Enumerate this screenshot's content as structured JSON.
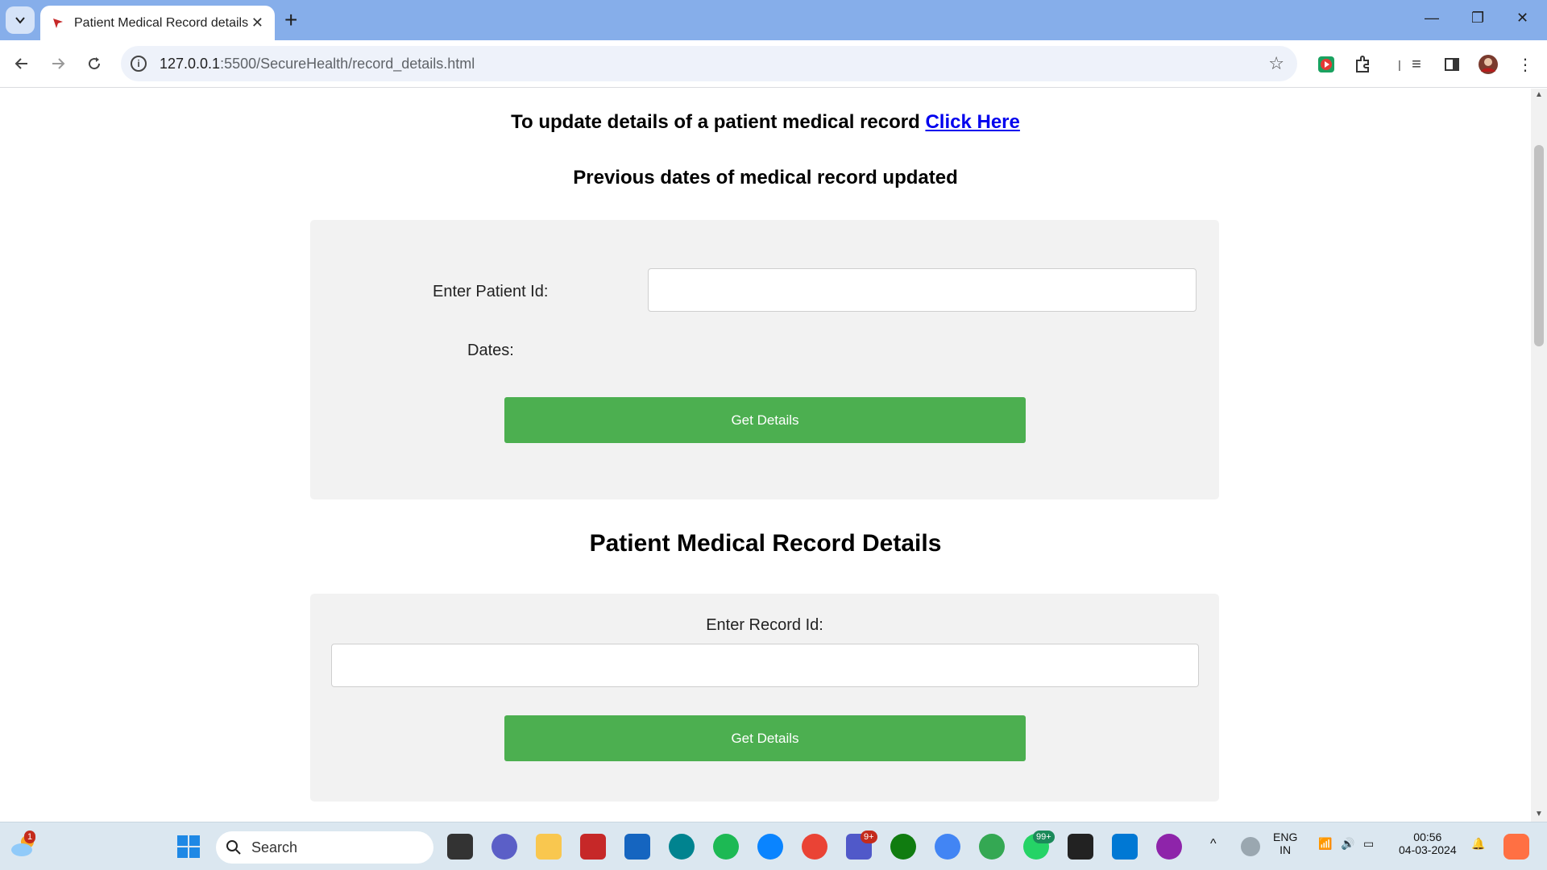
{
  "browser": {
    "tab_title": "Patient Medical Record details",
    "url_host": "127.0.0.1",
    "url_path": ":5500/SecureHealth/record_details.html"
  },
  "page": {
    "update_text": "To update details of a patient medical record",
    "update_link": "Click Here",
    "prev_dates_title": "Previous dates of medical record updated",
    "form1": {
      "patient_id_label": "Enter Patient Id:",
      "patient_id_value": "",
      "dates_label": "Dates:",
      "button_label": "Get Details"
    },
    "details_title": "Patient Medical Record Details",
    "form2": {
      "record_id_label": "Enter Record Id:",
      "record_id_value": "",
      "button_label": "Get Details"
    }
  },
  "taskbar": {
    "search_label": "Search",
    "weather_badge": "1",
    "teams_badge": "9+",
    "whatsapp_badge": "99+",
    "lang_line1": "ENG",
    "lang_line2": "IN",
    "time": "00:56",
    "date": "04-03-2024"
  },
  "colors": {
    "accent_green": "#4caf50",
    "link_blue": "#0000ee",
    "panel_bg": "#f2f2f2",
    "chrome_frame": "#86aeea"
  }
}
